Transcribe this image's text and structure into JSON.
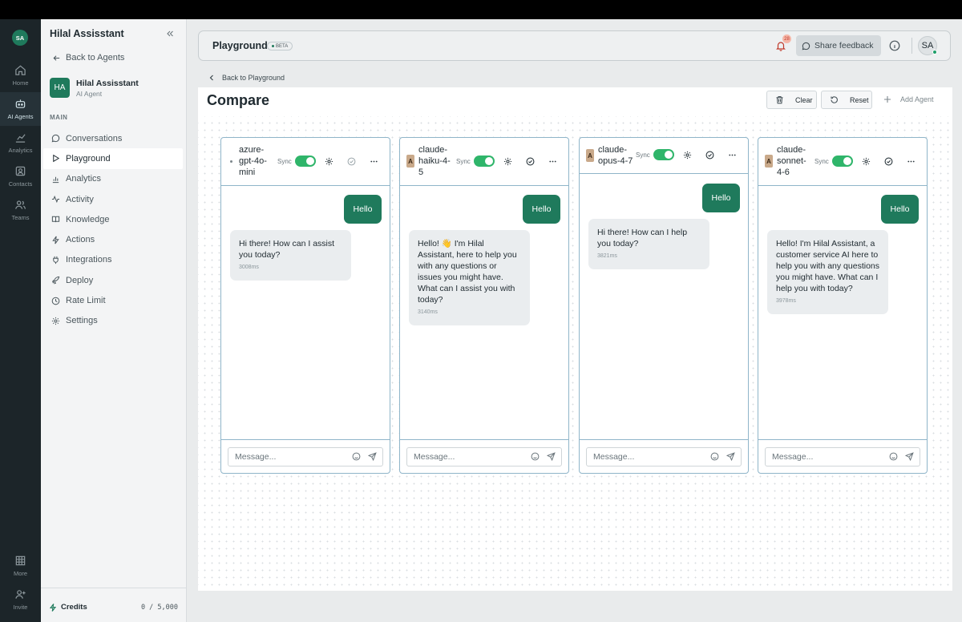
{
  "rail": {
    "avatar": "SA",
    "items": [
      {
        "label": "Home",
        "icon": "home-icon"
      },
      {
        "label": "AI Agents",
        "icon": "bot-icon"
      },
      {
        "label": "Analytics",
        "icon": "chart-icon"
      },
      {
        "label": "Contacts",
        "icon": "contacts-icon"
      },
      {
        "label": "Teams",
        "icon": "teams-icon"
      },
      {
        "label": "More",
        "icon": "grid-icon"
      },
      {
        "label": "Invite",
        "icon": "user-plus-icon"
      }
    ]
  },
  "sidebar": {
    "title": "Hilal Assisstant",
    "back_label": "Back to Agents",
    "agent": {
      "initials": "HA",
      "name": "Hilal Assisstant",
      "type": "AI Agent"
    },
    "section_label": "MAIN",
    "nav": [
      {
        "label": "Conversations",
        "icon": "chat-icon"
      },
      {
        "label": "Playground",
        "icon": "play-icon"
      },
      {
        "label": "Analytics",
        "icon": "bar-chart-icon"
      },
      {
        "label": "Activity",
        "icon": "activity-icon"
      },
      {
        "label": "Knowledge",
        "icon": "book-icon"
      },
      {
        "label": "Actions",
        "icon": "bolt-icon"
      },
      {
        "label": "Integrations",
        "icon": "plug-icon"
      },
      {
        "label": "Deploy",
        "icon": "rocket-icon"
      },
      {
        "label": "Rate Limit",
        "icon": "clock-icon"
      },
      {
        "label": "Settings",
        "icon": "gear-icon"
      }
    ],
    "active_nav": "Playground",
    "credits_label": "Credits",
    "credits_value": "0 / 5,000"
  },
  "header": {
    "title": "Playground",
    "badge": "BETA",
    "notification_count": "28",
    "feedback_label": "Share feedback",
    "user_initials": "SA"
  },
  "breadcrumb": {
    "back_label": "Back to Playground"
  },
  "compare": {
    "title": "Compare",
    "clear_label": "Clear",
    "reset_label": "Reset",
    "add_agent_label": "Add Agent"
  },
  "panels": [
    {
      "model": "azure-gpt-4o-mini",
      "name_lines": [
        "azure-",
        "gpt-4o-",
        "mini"
      ],
      "sync_label": "Sync",
      "sync_on": true,
      "user_message": "Hello",
      "reply": "Hi there! How can I assist you today?",
      "latency": "3008ms",
      "input_placeholder": "Message..."
    },
    {
      "model": "claude-haiku-4-5",
      "name_lines": [
        "claude-",
        "haiku-4-",
        "5"
      ],
      "sync_label": "Sync",
      "sync_on": true,
      "user_message": "Hello",
      "reply": "Hello! 👋 I'm Hilal Assistant, here to help you with any questions or issues you might have. What can I assist you with today?",
      "latency": "3140ms",
      "input_placeholder": "Message..."
    },
    {
      "model": "claude-opus-4-7",
      "name_lines": [
        "claude-",
        "opus-4-7"
      ],
      "sync_label": "Sync",
      "sync_on": true,
      "user_message": "Hello",
      "reply": "Hi there! How can I help you today?",
      "latency": "3821ms",
      "input_placeholder": "Message..."
    },
    {
      "model": "claude-sonnet-4-6",
      "name_lines": [
        "claude-",
        "sonnet-",
        "4-6"
      ],
      "sync_label": "Sync",
      "sync_on": true,
      "user_message": "Hello",
      "reply": "Hello! I'm Hilal Assistant, a customer service AI here to help you with any questions you might have. What can I help you with today?",
      "latency": "3978ms",
      "input_placeholder": "Message..."
    }
  ],
  "colors": {
    "brand": "#1f7a5c",
    "toggle_on": "#2fb56a",
    "panel_border": "#8fb5c9",
    "rail_bg": "#1c2529"
  }
}
